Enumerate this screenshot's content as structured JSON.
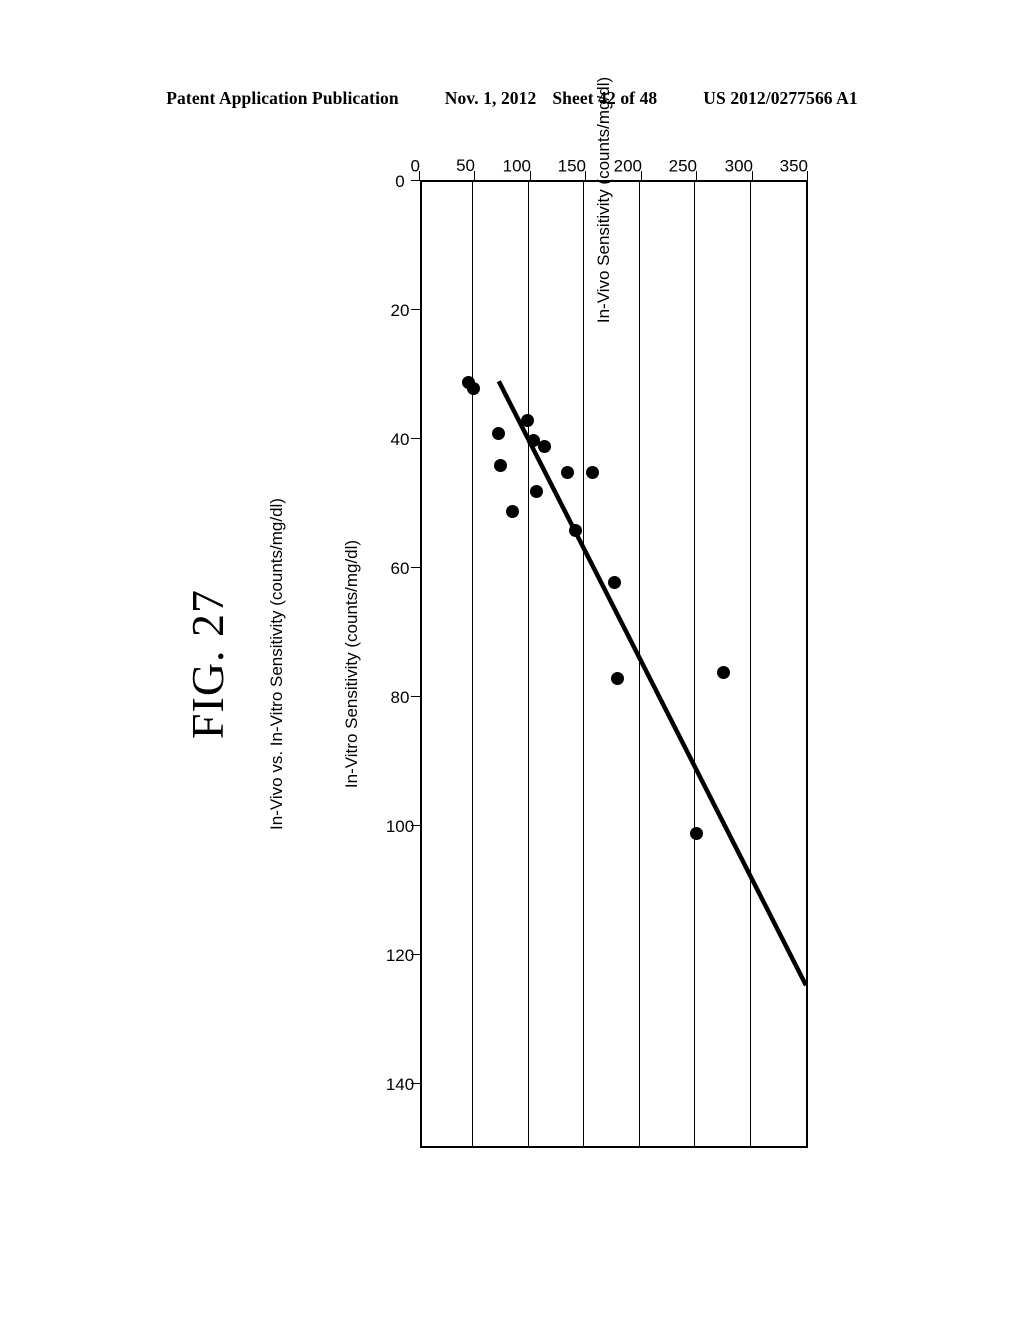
{
  "header": {
    "publication": "Patent Application Publication",
    "date": "Nov. 1, 2012",
    "sheet": "Sheet 42 of 48",
    "patent_number": "US 2012/0277566 A1"
  },
  "figure": {
    "label": "FIG. 27",
    "caption": "In-Vivo vs. In-Vitro Sensitivity (counts/mg/dl)"
  },
  "chart_data": {
    "type": "scatter",
    "title": "In-Vivo vs. In-Vitro Sensitivity (counts/mg/dl)",
    "xlabel": "In-Vitro Sensitivity (counts/mg/dl)",
    "ylabel": "In-Vivo Sensitivity (counts/mg/dl)",
    "xlim": [
      0,
      150
    ],
    "ylim": [
      0,
      350
    ],
    "xticks": [
      0,
      20,
      40,
      60,
      80,
      100,
      120,
      140
    ],
    "yticks": [
      0,
      50,
      100,
      150,
      200,
      250,
      300,
      350
    ],
    "grid": "horizontal-only",
    "legend": "none",
    "marker": "filled-circle",
    "points": [
      {
        "x": 101,
        "y": 251
      },
      {
        "x": 76,
        "y": 276
      },
      {
        "x": 77,
        "y": 180
      },
      {
        "x": 62,
        "y": 177
      },
      {
        "x": 54,
        "y": 142
      },
      {
        "x": 51,
        "y": 85
      },
      {
        "x": 48,
        "y": 107
      },
      {
        "x": 45,
        "y": 157
      },
      {
        "x": 45,
        "y": 135
      },
      {
        "x": 44,
        "y": 74
      },
      {
        "x": 41,
        "y": 114
      },
      {
        "x": 40,
        "y": 104
      },
      {
        "x": 39,
        "y": 73
      },
      {
        "x": 37,
        "y": 99
      },
      {
        "x": 32,
        "y": 50
      },
      {
        "x": 31,
        "y": 46
      }
    ],
    "trendline": {
      "type": "linear-fit",
      "x_start": 31,
      "y_start": 70,
      "x_end": 125,
      "y_end": 350
    }
  }
}
